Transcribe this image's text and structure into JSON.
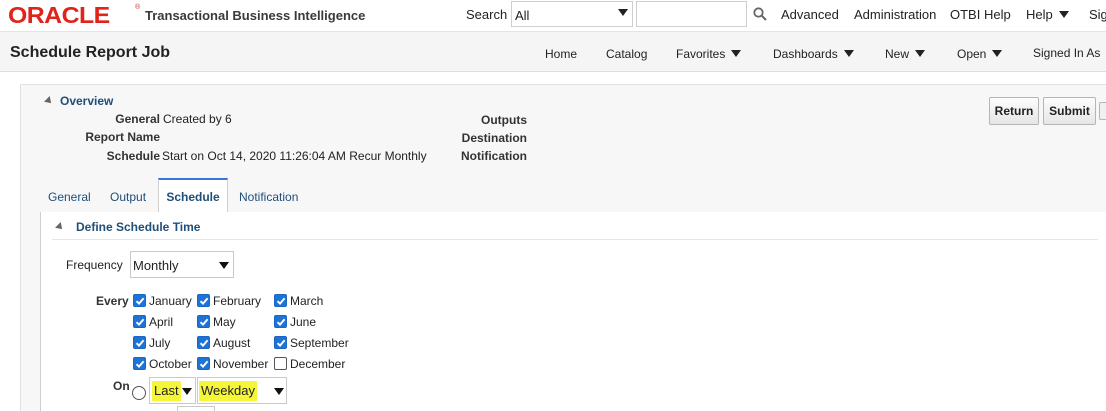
{
  "brand": {
    "logo": "ORACLE",
    "registered": "®",
    "product": "Transactional Business Intelligence"
  },
  "search": {
    "label": "Search",
    "scope_value": "All",
    "query_value": "",
    "query_placeholder": ""
  },
  "top_links": [
    "Advanced",
    "Administration",
    "OTBI Help",
    "Help",
    "Sig"
  ],
  "page": {
    "title": "Schedule Report Job"
  },
  "nav_links": [
    "Home",
    "Catalog",
    "Favorites",
    "Dashboards",
    "New",
    "Open",
    "Signed In As"
  ],
  "overview": {
    "title": "Overview",
    "general_label": "General",
    "general_value": "Created by 6",
    "report_name_label": "Report Name",
    "report_name_value": "",
    "schedule_label": "Schedule",
    "schedule_value": "Start on Oct 14, 2020 11:26:04 AM Recur Monthly",
    "outputs_label": "Outputs",
    "destination_label": "Destination",
    "notification_label": "Notification"
  },
  "buttons": {
    "return": "Return",
    "submit": "Submit"
  },
  "tabs": [
    "General",
    "Output",
    "Schedule",
    "Notification"
  ],
  "active_tab": "Schedule",
  "schedule": {
    "section_title": "Define Schedule Time",
    "frequency_label": "Frequency",
    "frequency_value": "Monthly",
    "every_label": "Every",
    "months": [
      {
        "name": "January",
        "checked": true
      },
      {
        "name": "February",
        "checked": true
      },
      {
        "name": "March",
        "checked": true
      },
      {
        "name": "April",
        "checked": true
      },
      {
        "name": "May",
        "checked": true
      },
      {
        "name": "June",
        "checked": true
      },
      {
        "name": "July",
        "checked": true
      },
      {
        "name": "August",
        "checked": true
      },
      {
        "name": "September",
        "checked": true
      },
      {
        "name": "October",
        "checked": true
      },
      {
        "name": "November",
        "checked": true
      },
      {
        "name": "December",
        "checked": false
      }
    ],
    "on_label": "On",
    "on_position_value": "Last",
    "on_day_value": "Weekday"
  },
  "colors": {
    "oracle_red": "#e2231a",
    "link_blue": "#1f4e79",
    "checkbox_blue": "#1e73d6",
    "highlight_yellow": "#f5f53a"
  },
  "icons": {
    "search": "magnifier-icon",
    "dropdown": "triangle-down-icon",
    "collapse": "triangle-collapse-icon"
  }
}
